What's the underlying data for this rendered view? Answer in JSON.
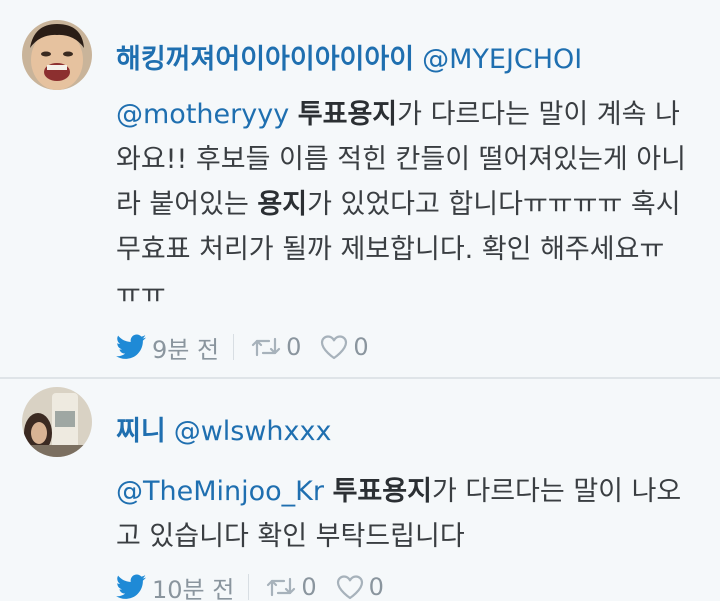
{
  "tweets": [
    {
      "display_name": "해킹꺼져어이아이아이아이",
      "handle": "@MYEJCHOI",
      "body": {
        "mention": "@motheryyy",
        "s1": " ",
        "b1": "투표용지",
        "s2": "가 다르다는 말이 계속 나와요!! 후보들 이름 적힌 칸들이 떨어져있는게 아니라 붙어있는 ",
        "b2": "용지",
        "s3": "가 있었다고 합니다ㅠㅠㅠㅠ 혹시 무효표 처리가 될까 제보합니다. 확인 해주세요ㅠㅠㅠ"
      },
      "time": "9분 전",
      "retweets": "0",
      "likes": "0"
    },
    {
      "display_name": "찌니",
      "handle": "@wlswhxxx",
      "body": {
        "mention": "@TheMinjoo_Kr",
        "s1": " ",
        "b1": "투표용지",
        "s2": "가 다르다는 말이 나오고 있습니다 확인 부탁드립니다"
      },
      "time": "10분 전",
      "retweets": "0",
      "likes": "0"
    }
  ],
  "icons": {
    "time": "twitter-bird-icon",
    "retweet": "retweet-icon",
    "like": "heart-icon"
  },
  "colors": {
    "link": "#1f6fb0",
    "text": "#3a3e42",
    "muted": "#8a959e",
    "background": "#f5f8fa"
  }
}
